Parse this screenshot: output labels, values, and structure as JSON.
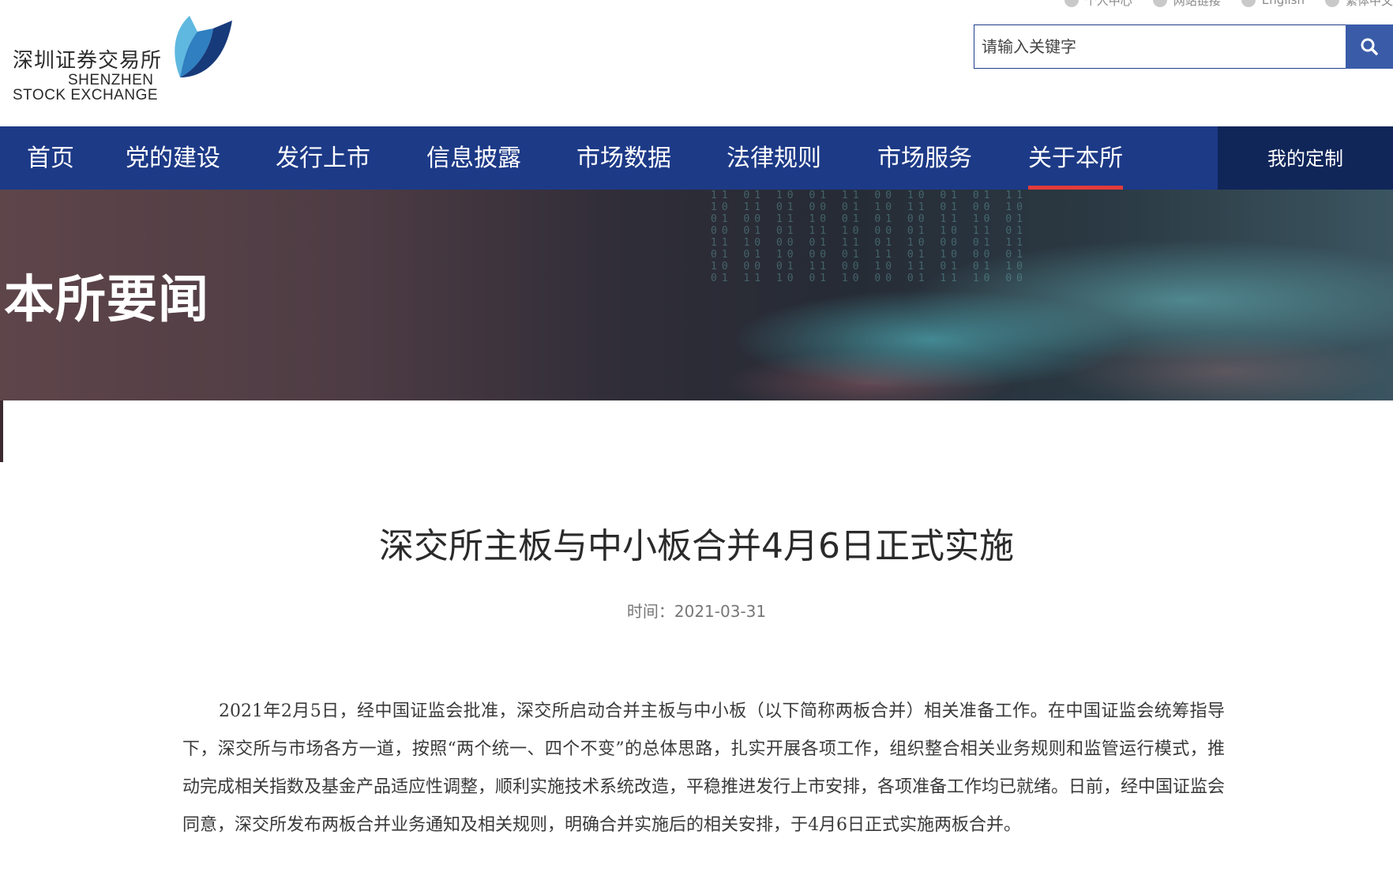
{
  "logo": {
    "cn": "深圳证券交易所",
    "en_line1": "SHENZHEN",
    "en_line2": "STOCK EXCHANGE"
  },
  "toplinks": [
    "个人中心",
    "网站链接",
    "English",
    "繁体中文"
  ],
  "search": {
    "placeholder": "请输入关键字",
    "icon": "search-icon"
  },
  "nav": {
    "items": [
      "首页",
      "党的建设",
      "发行上市",
      "信息披露",
      "市场数据",
      "法律规则",
      "市场服务",
      "关于本所"
    ],
    "active_index": 7,
    "custom_label": "我的定制"
  },
  "banner": {
    "title": "本所要闻"
  },
  "article": {
    "title": "深交所主板与中小板合并4月6日正式实施",
    "date": "时间：2021-03-31",
    "body": "2021年2月5日，经中国证监会批准，深交所启动合并主板与中小板（以下简称两板合并）相关准备工作。在中国证监会统筹指导下，深交所与市场各方一道，按照“两个统一、四个不变”的总体思路，扎实开展各项工作，组织整合相关业务规则和监管运行模式，推动完成相关指数及基金产品适应性调整，顺利实施技术系统改造，平稳推进发行上市安排，各项准备工作均已就绪。日前，经中国证监会同意，深交所发布两板合并业务通知及相关规则，明确合并实施后的相关安排，于4月6日正式实施两板合并。"
  },
  "colors": {
    "nav_bg": "#1d3a87",
    "nav_active_underline": "#e23b3b",
    "custom_bg": "#102659",
    "search_btn": "#3a5ca8"
  }
}
